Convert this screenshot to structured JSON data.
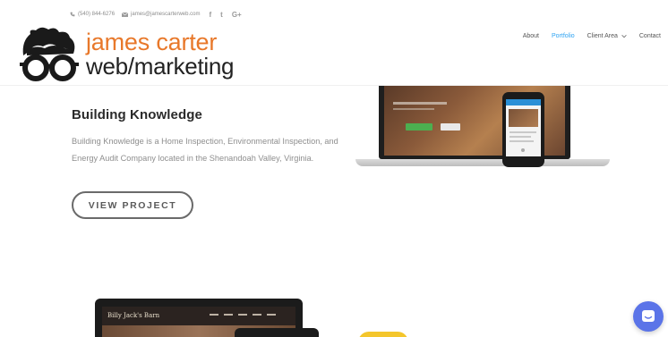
{
  "topbar": {
    "phone": "(540) 844-6276",
    "email": "james@jamescarterweb.com",
    "social": [
      "f",
      "t",
      "G+"
    ]
  },
  "brand": {
    "line1": "james carter",
    "line2": "web/marketing"
  },
  "nav": {
    "items": [
      "About",
      "Portfolio",
      "Client Area",
      "Contact"
    ],
    "active": "Portfolio"
  },
  "project": {
    "title": "Building Knowledge",
    "description": "Building Knowledge is a Home Inspection, Environmental Inspection, and Energy Audit Company located in the Shenandoah Valley, Virginia.",
    "button_label": "VIEW PROJECT"
  },
  "mockup2": {
    "site_name": "Billy Jack's Barn"
  },
  "colors": {
    "accent": "#e8782a",
    "nav_active": "#2ea3f2",
    "chat": "#5b74e8"
  },
  "icons": {
    "phone": "phone-icon",
    "email": "envelope-icon",
    "chat": "chat-icon",
    "dropdown": "chevron-down-icon"
  }
}
